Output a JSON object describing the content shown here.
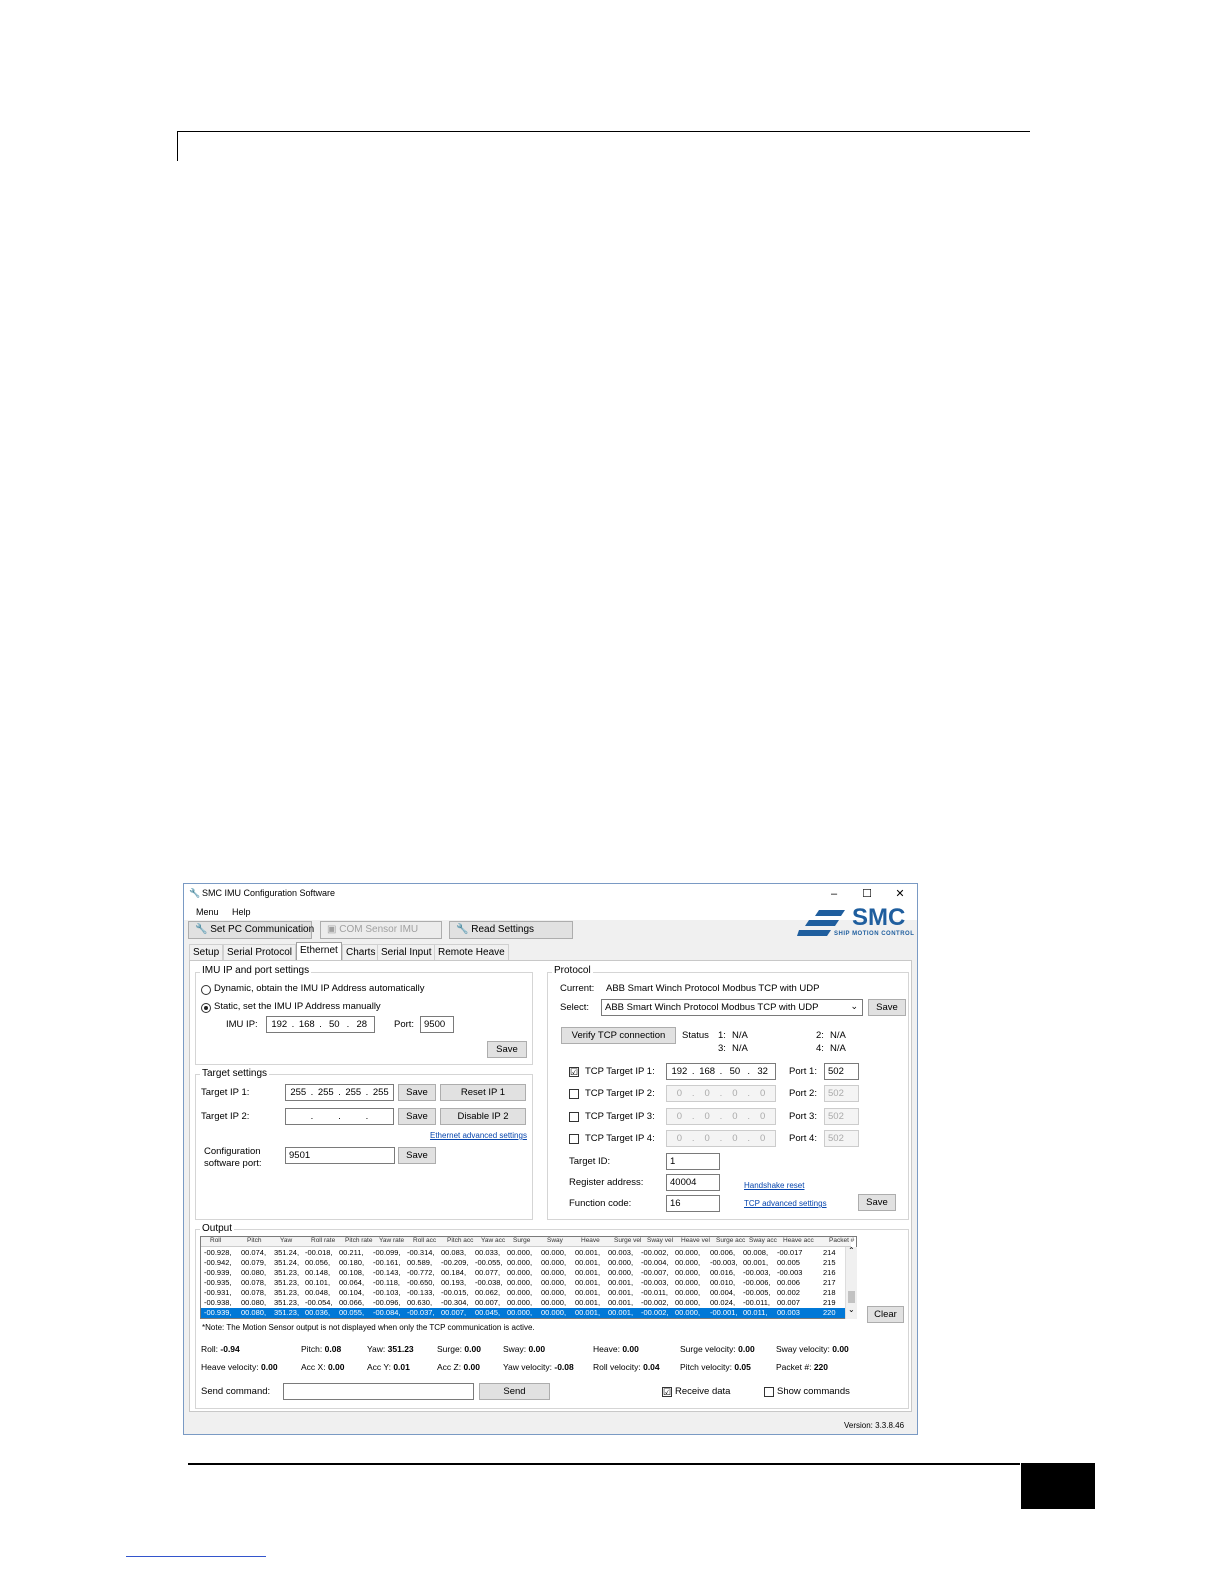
{
  "window": {
    "title": "SMC IMU Configuration Software",
    "controls": {
      "minimize": "–",
      "maximize": "☐",
      "close": "✕"
    },
    "version": "Version: 3.3.8.46"
  },
  "menu": {
    "items": [
      "Menu",
      "Help"
    ]
  },
  "toolbar": {
    "set_pc_comm": "Set PC Communication",
    "com_sensor": "COM Sensor IMU",
    "read_settings": "Read Settings"
  },
  "logo": {
    "name": "SMC",
    "tagline": "SHIP MOTION CONTROL",
    "color": "#1f5e9e"
  },
  "tabs": [
    "Setup",
    "Serial Protocol",
    "Ethernet",
    "Charts",
    "Serial Input",
    "Remote Heave"
  ],
  "imu_ip": {
    "title": "IMU IP and port settings",
    "dynamic_label": "Dynamic, obtain the IMU IP Address automatically",
    "static_label": "Static, set the IMU IP Address manually",
    "ip_label": "IMU IP:",
    "ip": [
      "192",
      "168",
      "50",
      "28"
    ],
    "port_label": "Port:",
    "port": "9500",
    "save": "Save"
  },
  "target": {
    "title": "Target settings",
    "ip1_label": "Target IP 1:",
    "ip1": [
      "255",
      "255",
      "255",
      "255"
    ],
    "ip2_label": "Target IP 2:",
    "ip2": [
      "",
      "",
      "",
      ""
    ],
    "save": "Save",
    "reset_ip1": "Reset IP 1",
    "disable_ip2": "Disable IP 2",
    "advanced_link": "Ethernet advanced settings",
    "config_port_label_1": "Configuration",
    "config_port_label_2": "software port:",
    "config_port": "9501"
  },
  "protocol": {
    "title": "Protocol",
    "current_label": "Current:",
    "current": "ABB Smart Winch Protocol Modbus TCP with UDP",
    "select_label": "Select:",
    "selected": "ABB Smart Winch Protocol Modbus TCP with UDP",
    "save": "Save",
    "verify": "Verify TCP connection",
    "status_label": "Status",
    "status": [
      {
        "n": "1:",
        "v": "N/A"
      },
      {
        "n": "2:",
        "v": "N/A"
      },
      {
        "n": "3:",
        "v": "N/A"
      },
      {
        "n": "4:",
        "v": "N/A"
      }
    ],
    "targets": [
      {
        "label": "TCP Target IP 1:",
        "checked": "☑",
        "ip": [
          "192",
          "168",
          "50",
          "32"
        ],
        "port_label": "Port 1:",
        "port": "502"
      },
      {
        "label": "TCP Target IP 2:",
        "checked": "",
        "ip": [
          "0",
          "0",
          "0",
          "0"
        ],
        "port_label": "Port 2:",
        "port": "502"
      },
      {
        "label": "TCP Target IP 3:",
        "checked": "",
        "ip": [
          "0",
          "0",
          "0",
          "0"
        ],
        "port_label": "Port 3:",
        "port": "502"
      },
      {
        "label": "TCP Target IP 4:",
        "checked": "",
        "ip": [
          "0",
          "0",
          "0",
          "0"
        ],
        "port_label": "Port 4:",
        "port": "502"
      }
    ],
    "target_id_label": "Target ID:",
    "target_id": "1",
    "register_label": "Register address:",
    "register": "40004",
    "function_label": "Function code:",
    "function": "16",
    "handshake_link": "Handshake reset",
    "tcp_adv_link": "TCP advanced settings"
  },
  "output": {
    "title": "Output",
    "columns": [
      "Roll",
      "Pitch",
      "Yaw",
      "Roll rate",
      "Pitch rate",
      "Yaw rate",
      "Roll acc",
      "Pitch acc",
      "Yaw acc",
      "Surge",
      "Sway",
      "Heave",
      "Surge vel",
      "Sway vel",
      "Heave vel",
      "Surge acc",
      "Sway acc",
      "Heave acc",
      "Packet #"
    ],
    "rows": [
      [
        "-00.928,",
        "00.074,",
        "351.24,",
        "-00.018,",
        "00.211,",
        "-00.099,",
        "-00.314,",
        "00.083,",
        "00.033,",
        "00.000,",
        "00.000,",
        "00.001,",
        "00.003,",
        "-00.002,",
        "00.000,",
        "00.006,",
        "00.008,",
        "-00.017",
        "214"
      ],
      [
        "-00.942,",
        "00.079,",
        "351.24,",
        "00.056,",
        "00.180,",
        "-00.161,",
        "00.589,",
        "-00.209,",
        "-00.055,",
        "00.000,",
        "00.000,",
        "00.001,",
        "00.000,",
        "-00.004,",
        "00.000,",
        "-00.003,",
        "00.001,",
        "00.005",
        "215"
      ],
      [
        "-00.939,",
        "00.080,",
        "351.23,",
        "00.148,",
        "00.108,",
        "-00.143,",
        "-00.772,",
        "00.184,",
        "00.077,",
        "00.000,",
        "00.000,",
        "00.001,",
        "00.000,",
        "-00.007,",
        "00.000,",
        "00.016,",
        "-00.003,",
        "-00.003",
        "216"
      ],
      [
        "-00.935,",
        "00.078,",
        "351.23,",
        "00.101,",
        "00.064,",
        "-00.118,",
        "-00.650,",
        "00.193,",
        "-00.038,",
        "00.000,",
        "00.000,",
        "00.001,",
        "00.001,",
        "-00.003,",
        "00.000,",
        "00.010,",
        "-00.006,",
        "00.006",
        "217"
      ],
      [
        "-00.931,",
        "00.078,",
        "351.23,",
        "00.048,",
        "00.104,",
        "-00.103,",
        "-00.133,",
        "-00.015,",
        "00.062,",
        "00.000,",
        "00.000,",
        "00.001,",
        "00.001,",
        "-00.011,",
        "00.000,",
        "00.004,",
        "-00.005,",
        "00.002",
        "218"
      ],
      [
        "-00.938,",
        "00.080,",
        "351.23,",
        "-00.054,",
        "00.066,",
        "-00.096,",
        "00.630,",
        "-00.304,",
        "00.007,",
        "00.000,",
        "00.000,",
        "00.001,",
        "00.001,",
        "-00.002,",
        "00.000,",
        "00.024,",
        "-00.011,",
        "00.007",
        "219"
      ],
      [
        "-00.939,",
        "00.080,",
        "351.23,",
        "00.036,",
        "00.055,",
        "-00.084,",
        "-00.037,",
        "00.007,",
        "00.045,",
        "00.000,",
        "00.000,",
        "00.001,",
        "00.001,",
        "-00.002,",
        "00.000,",
        "-00.001,",
        "00.011,",
        "00.003",
        "220"
      ]
    ],
    "clear": "Clear",
    "note": "*Note: The Motion Sensor output is not displayed when only the TCP communication is active.",
    "values1": [
      {
        "l": "Roll:",
        "v": "-0.94"
      },
      {
        "l": "Pitch:",
        "v": "0.08"
      },
      {
        "l": "Yaw:",
        "v": "351.23"
      },
      {
        "l": "Surge:",
        "v": "0.00"
      },
      {
        "l": "Sway:",
        "v": "0.00"
      },
      {
        "l": "Heave:",
        "v": "0.00"
      },
      {
        "l": "Surge velocity:",
        "v": "0.00"
      },
      {
        "l": "Sway velocity:",
        "v": "0.00"
      }
    ],
    "values2": [
      {
        "l": "Heave velocity:",
        "v": "0.00"
      },
      {
        "l": "Acc X:",
        "v": "0.00"
      },
      {
        "l": "Acc Y:",
        "v": "0.01"
      },
      {
        "l": "Acc Z:",
        "v": "0.00"
      },
      {
        "l": "Yaw velocity:",
        "v": "-0.08"
      },
      {
        "l": "Roll velocity:",
        "v": "0.04"
      },
      {
        "l": "Pitch velocity:",
        "v": "0.05"
      },
      {
        "l": "Packet #:",
        "v": "220"
      }
    ],
    "send_label": "Send command:",
    "send_value": "",
    "send": "Send",
    "receive_label": "Receive data",
    "receive_checked": "☑",
    "show_label": "Show commands",
    "show_checked": ""
  }
}
